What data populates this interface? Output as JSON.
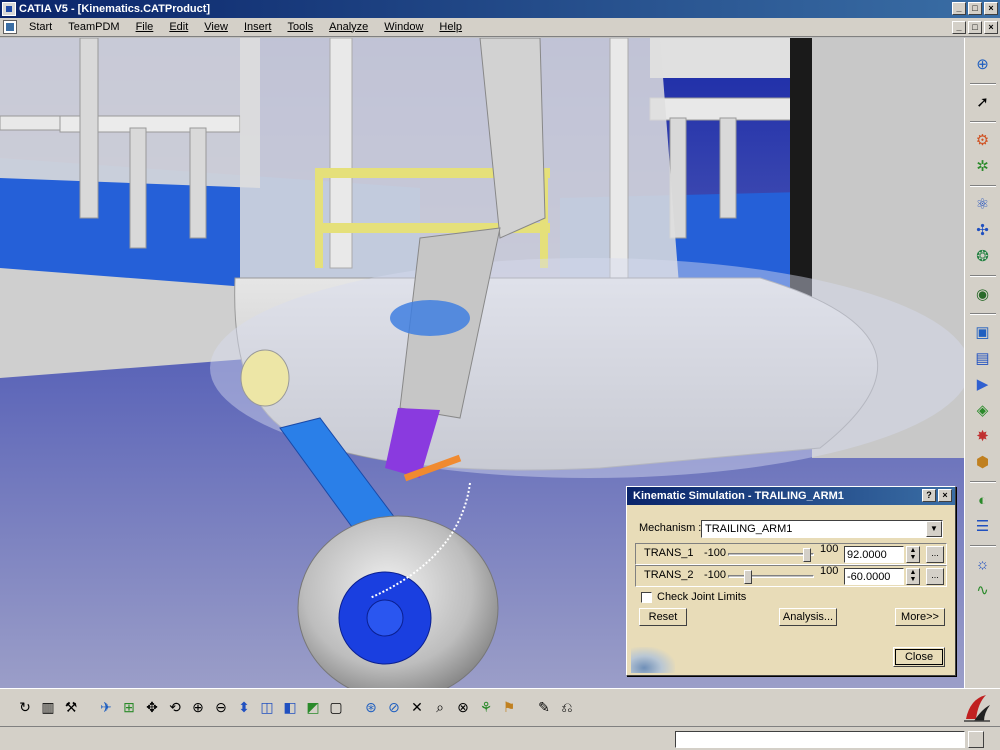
{
  "window": {
    "title": "CATIA V5 - [Kinematics.CATProduct]",
    "controls": [
      "_",
      "□",
      "×"
    ]
  },
  "menubar": {
    "items": [
      "Start",
      "TeamPDM",
      "File",
      "Edit",
      "View",
      "Insert",
      "Tools",
      "Analyze",
      "Window",
      "Help"
    ],
    "doc_controls": [
      "_",
      "□",
      "×"
    ]
  },
  "dialog": {
    "title": "Kinematic Simulation - TRAILING_ARM1",
    "title_buttons": [
      "?",
      "×"
    ],
    "mechanism_label": "Mechanism :",
    "mechanism_value": "TRAILING_ARM1",
    "commands": [
      {
        "name": "TRANS_1",
        "min": "-100",
        "max": "100",
        "value": "92.0000",
        "position": 0.96
      },
      {
        "name": "TRANS_2",
        "min": "-100",
        "max": "100",
        "value": "-60.0000",
        "position": 0.2
      }
    ],
    "dots_label": "...",
    "check_joint_limits": {
      "label": "Check Joint Limits",
      "checked": false
    },
    "buttons": {
      "reset": "Reset",
      "analysis": "Analysis...",
      "more": "More>>",
      "close": "Close"
    }
  },
  "statusbar": {
    "input_value": ""
  },
  "colors": {
    "background_blue": "#1b2395",
    "dialog_bg": "#e8dcb8",
    "title_gradient_start": "#0a246a",
    "title_gradient_end": "#3a6ea5"
  },
  "icons": {
    "right_toolbar": [
      "navigator-icon",
      "select-arrow-icon",
      "fixed-joint-icon",
      "revolute-joint-icon",
      "prismatic-joint-icon",
      "cylindrical-joint-icon",
      "screw-joint-icon",
      "mechanism-analysis-icon",
      "simulate-commands-icon",
      "compile-simulation-icon",
      "replay-icon",
      "sensors-icon",
      "clash-icon",
      "distance-icon",
      "sectioning-icon",
      "swept-volume-icon",
      "trace-icon",
      "law-icon"
    ],
    "bottom_toolbar": [
      "update-icon",
      "catalog-icon",
      "tools-icon",
      "fly-mode-icon",
      "fit-all-icon",
      "pan-icon",
      "rotate-icon",
      "zoom-in-icon",
      "zoom-out-icon",
      "normal-view-icon",
      "multi-view-icon",
      "iso-view-icon",
      "shading-icon",
      "hide-show-icon",
      "swap-visible-icon",
      "measure-icon",
      "section-icon",
      "clash-icon",
      "distance-icon",
      "search-icon",
      "snap-icon",
      "manipulate-icon",
      "explode-icon",
      "stop-icon",
      "logo-3ds"
    ]
  }
}
